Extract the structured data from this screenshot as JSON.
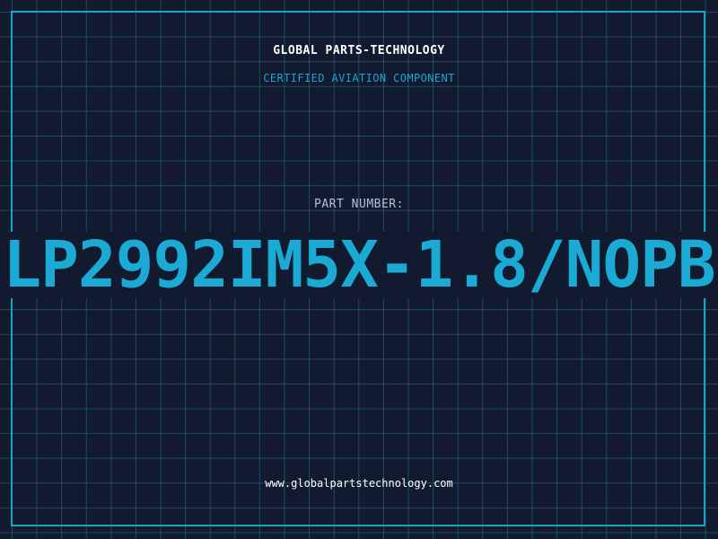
{
  "header": {
    "company": "GLOBAL PARTS-TECHNOLOGY",
    "subtitle": "CERTIFIED AVIATION COMPONENT"
  },
  "part": {
    "label": "PART NUMBER:",
    "number": "LP2992IM5X-1.8/NOPB"
  },
  "footer": {
    "website": "www.globalpartstechnology.com"
  },
  "colors": {
    "background": "#111a2e",
    "grid": "#23788c",
    "accent": "#1aaad4",
    "label": "#b9c2cf",
    "text": "#ffffff"
  }
}
